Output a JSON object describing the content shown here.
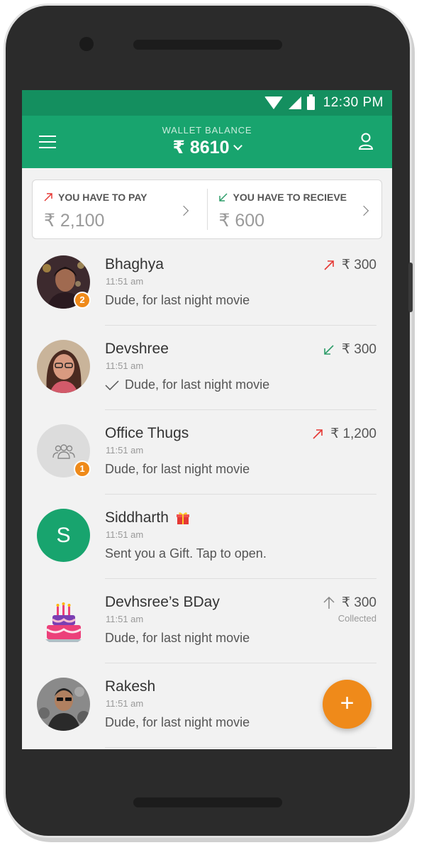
{
  "status_bar": {
    "time": "12:30 PM"
  },
  "header": {
    "wallet_label": "WALLET BALANCE",
    "wallet_balance": "₹ 8610",
    "menu_icon": "hamburger-icon",
    "profile_icon": "user-icon"
  },
  "summary": {
    "pay": {
      "label": "YOU HAVE TO PAY",
      "value": "₹ 2,100"
    },
    "receive": {
      "label": "YOU HAVE TO RECIEVE",
      "value": "₹ 600"
    }
  },
  "contacts": [
    {
      "name": "Bhaghya",
      "time": "11:51 am",
      "message": "Dude, for last night movie",
      "amount": "₹ 300",
      "direction": "out",
      "badge": "2"
    },
    {
      "name": "Devshree",
      "time": "11:51 am",
      "message": "Dude, for last night movie",
      "amount": "₹ 300",
      "direction": "in"
    },
    {
      "name": "Office Thugs",
      "time": "11:51 am",
      "message": "Dude, for last night movie",
      "amount": "₹ 1,200",
      "direction": "out",
      "badge": "1"
    },
    {
      "name": "Siddharth",
      "initial": "S",
      "time": "11:51 am",
      "message": "Sent you a Gift. Tap to open."
    },
    {
      "name": "Devhsree’s BDay",
      "time": "11:51 am",
      "message": "Dude, for last night movie",
      "amount": "₹ 300",
      "status": "Collected"
    },
    {
      "name": "Rakesh",
      "time": "11:51 am",
      "message": "Dude, for last night movie"
    }
  ],
  "fab": {
    "label": "+"
  },
  "colors": {
    "primary": "#18a46e",
    "primary_dark": "#148f5f",
    "accent": "#ef8a1a",
    "pay_arrow": "#e53935",
    "receive_arrow": "#2e9d6a"
  }
}
